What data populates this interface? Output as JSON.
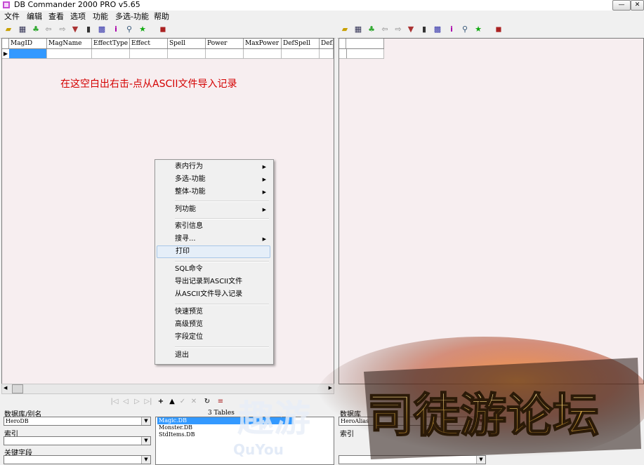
{
  "window": {
    "title": "DB Commander 2000 PRO v5.65",
    "minimize": "—",
    "close": "✕"
  },
  "menu": [
    "文件",
    "编辑",
    "查看",
    "选项",
    "功能",
    "多选-功能",
    "帮助"
  ],
  "grid": {
    "columns": [
      "MagID",
      "MagName",
      "EffectType",
      "Effect",
      "Spell",
      "Power",
      "MaxPower",
      "DefSpell",
      "DefP"
    ],
    "row_indicator": "▶"
  },
  "hint": "在这空白出右击-点从ASCII文件导入记录",
  "context_menu": {
    "items": [
      {
        "label": "表内行为",
        "submenu": true
      },
      {
        "label": "多选-功能",
        "submenu": true
      },
      {
        "label": "整体-功能",
        "submenu": true
      },
      {
        "label": "列功能",
        "submenu": true
      },
      {
        "label": "索引信息",
        "submenu": false
      },
      {
        "label": "搜寻...",
        "submenu": true
      },
      {
        "label": "打印",
        "submenu": false,
        "highlighted": true
      },
      {
        "label": "SQL命令",
        "submenu": false
      },
      {
        "label": "导出记录到ASCII文件",
        "submenu": false
      },
      {
        "label": "从ASCII文件导入记录",
        "submenu": false
      },
      {
        "label": "快速预览",
        "submenu": false
      },
      {
        "label": "高级预览",
        "submenu": false
      },
      {
        "label": "字段定位",
        "submenu": false
      },
      {
        "label": "退出",
        "submenu": false
      }
    ],
    "submenu_arrow": "▶"
  },
  "bottom": {
    "db_label": "数据库/别名",
    "db_value": "HeroDB",
    "index_label": "索引",
    "index_value": "",
    "keyfield_label": "关键字段",
    "keyfield_value": "",
    "table_count": "3 Tables",
    "tables": [
      "Magic.DB",
      "Monster.DB",
      "StdItems.DB"
    ],
    "selected_table": "Magic.DB",
    "right_db_label": "数据库",
    "right_db_value": "HeroAlias",
    "right_index_label": "索引"
  },
  "watermark": {
    "text": "司徒游论坛",
    "subtext": "趣游",
    "latin": "QuYou"
  },
  "colors": {
    "hint": "#d40000",
    "grid_bg": "#f7eef0",
    "selection": "#3399ff",
    "menu_highlight": "#e5eef8"
  }
}
